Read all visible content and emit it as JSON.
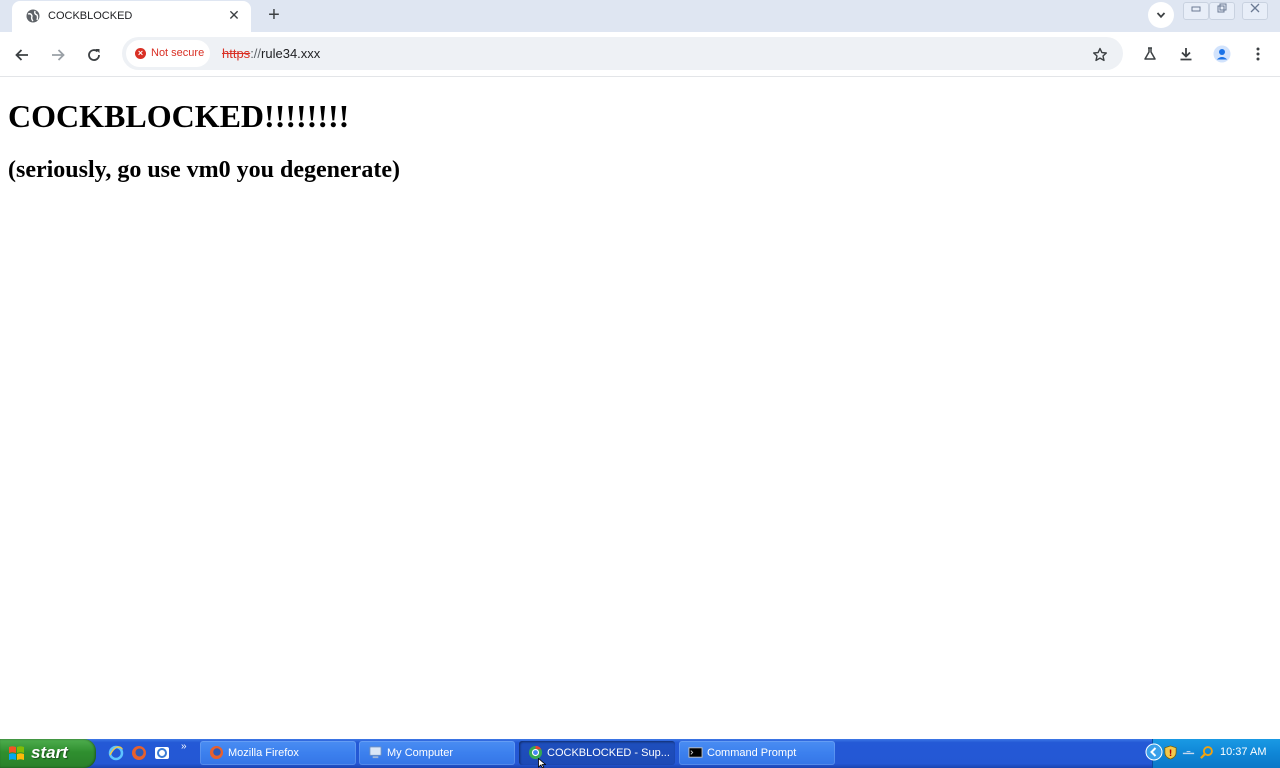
{
  "browser": {
    "tab": {
      "title": "COCKBLOCKED",
      "favicon": "globe-icon",
      "close_glyph": "✕"
    },
    "new_tab_glyph": "+",
    "tab_list_glyph": "⌄",
    "omnibox": {
      "security_label": "Not secure",
      "url_scheme": "https",
      "url_separator": "://",
      "url_host": "rule34.xxx"
    },
    "icons": {
      "back": "back-arrow-icon",
      "forward": "forward-arrow-icon",
      "reload": "reload-icon",
      "bookmark": "star-icon",
      "labs": "flask-icon",
      "download": "download-icon",
      "profile": "profile-icon",
      "menu": "kebab-menu-icon"
    }
  },
  "page": {
    "heading": "COCKBLOCKED!!!!!!!!",
    "subheading": "(seriously, go use vm0 you degenerate)"
  },
  "taskbar": {
    "start_label": "start",
    "quick_launch": [
      "internet-explorer-icon",
      "firefox-icon",
      "show-desktop-icon"
    ],
    "quick_launch_more": "»",
    "tasks": [
      {
        "label": "Mozilla Firefox",
        "icon": "firefox-icon",
        "active": false
      },
      {
        "label": "My Computer",
        "icon": "my-computer-icon",
        "active": false
      },
      {
        "label": "COCKBLOCKED - Sup...",
        "icon": "chrome-icon",
        "active": true
      },
      {
        "label": "Command Prompt",
        "icon": "cmd-icon",
        "active": false
      }
    ],
    "tray": {
      "icons": [
        "collapse-tray-icon",
        "security-shield-icon",
        "network-icon",
        "search-icon"
      ],
      "clock": "10:37 AM"
    }
  },
  "colors": {
    "taskbar_blue": "#2459d6",
    "start_green": "#2f8f2f",
    "tray_blue": "#0f86d6",
    "not_secure_red": "#d93025",
    "profile_blue": "#1a73e8"
  }
}
